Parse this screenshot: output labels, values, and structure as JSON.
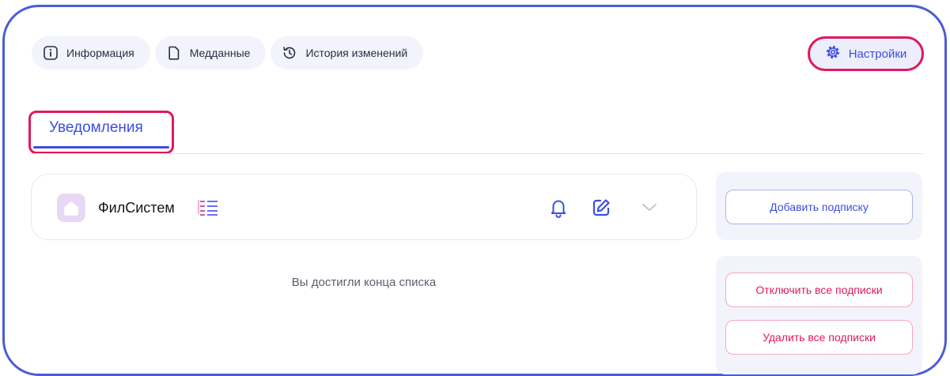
{
  "tabs": [
    {
      "label": "Информация",
      "icon": "info-icon"
    },
    {
      "label": "Медданные",
      "icon": "document-icon"
    },
    {
      "label": "История изменений",
      "icon": "history-icon"
    }
  ],
  "settings": {
    "label": "Настройки",
    "icon": "gear-icon"
  },
  "section_tab": {
    "label": "Уведомления"
  },
  "subscription": {
    "name": "ФилСистем",
    "icons": [
      "home-icon",
      "list-icon",
      "bell-icon",
      "edit-icon",
      "chevron-down-icon"
    ]
  },
  "list_end_text": "Вы достигли конца списка",
  "actions": {
    "add_label": "Добавить подписку",
    "disable_all_label": "Отключить все подписки",
    "delete_all_label": "Удалить все подписки"
  },
  "colors": {
    "accent": "#3c4ee0",
    "danger": "#e0185e",
    "frame": "#4b5cd6"
  }
}
